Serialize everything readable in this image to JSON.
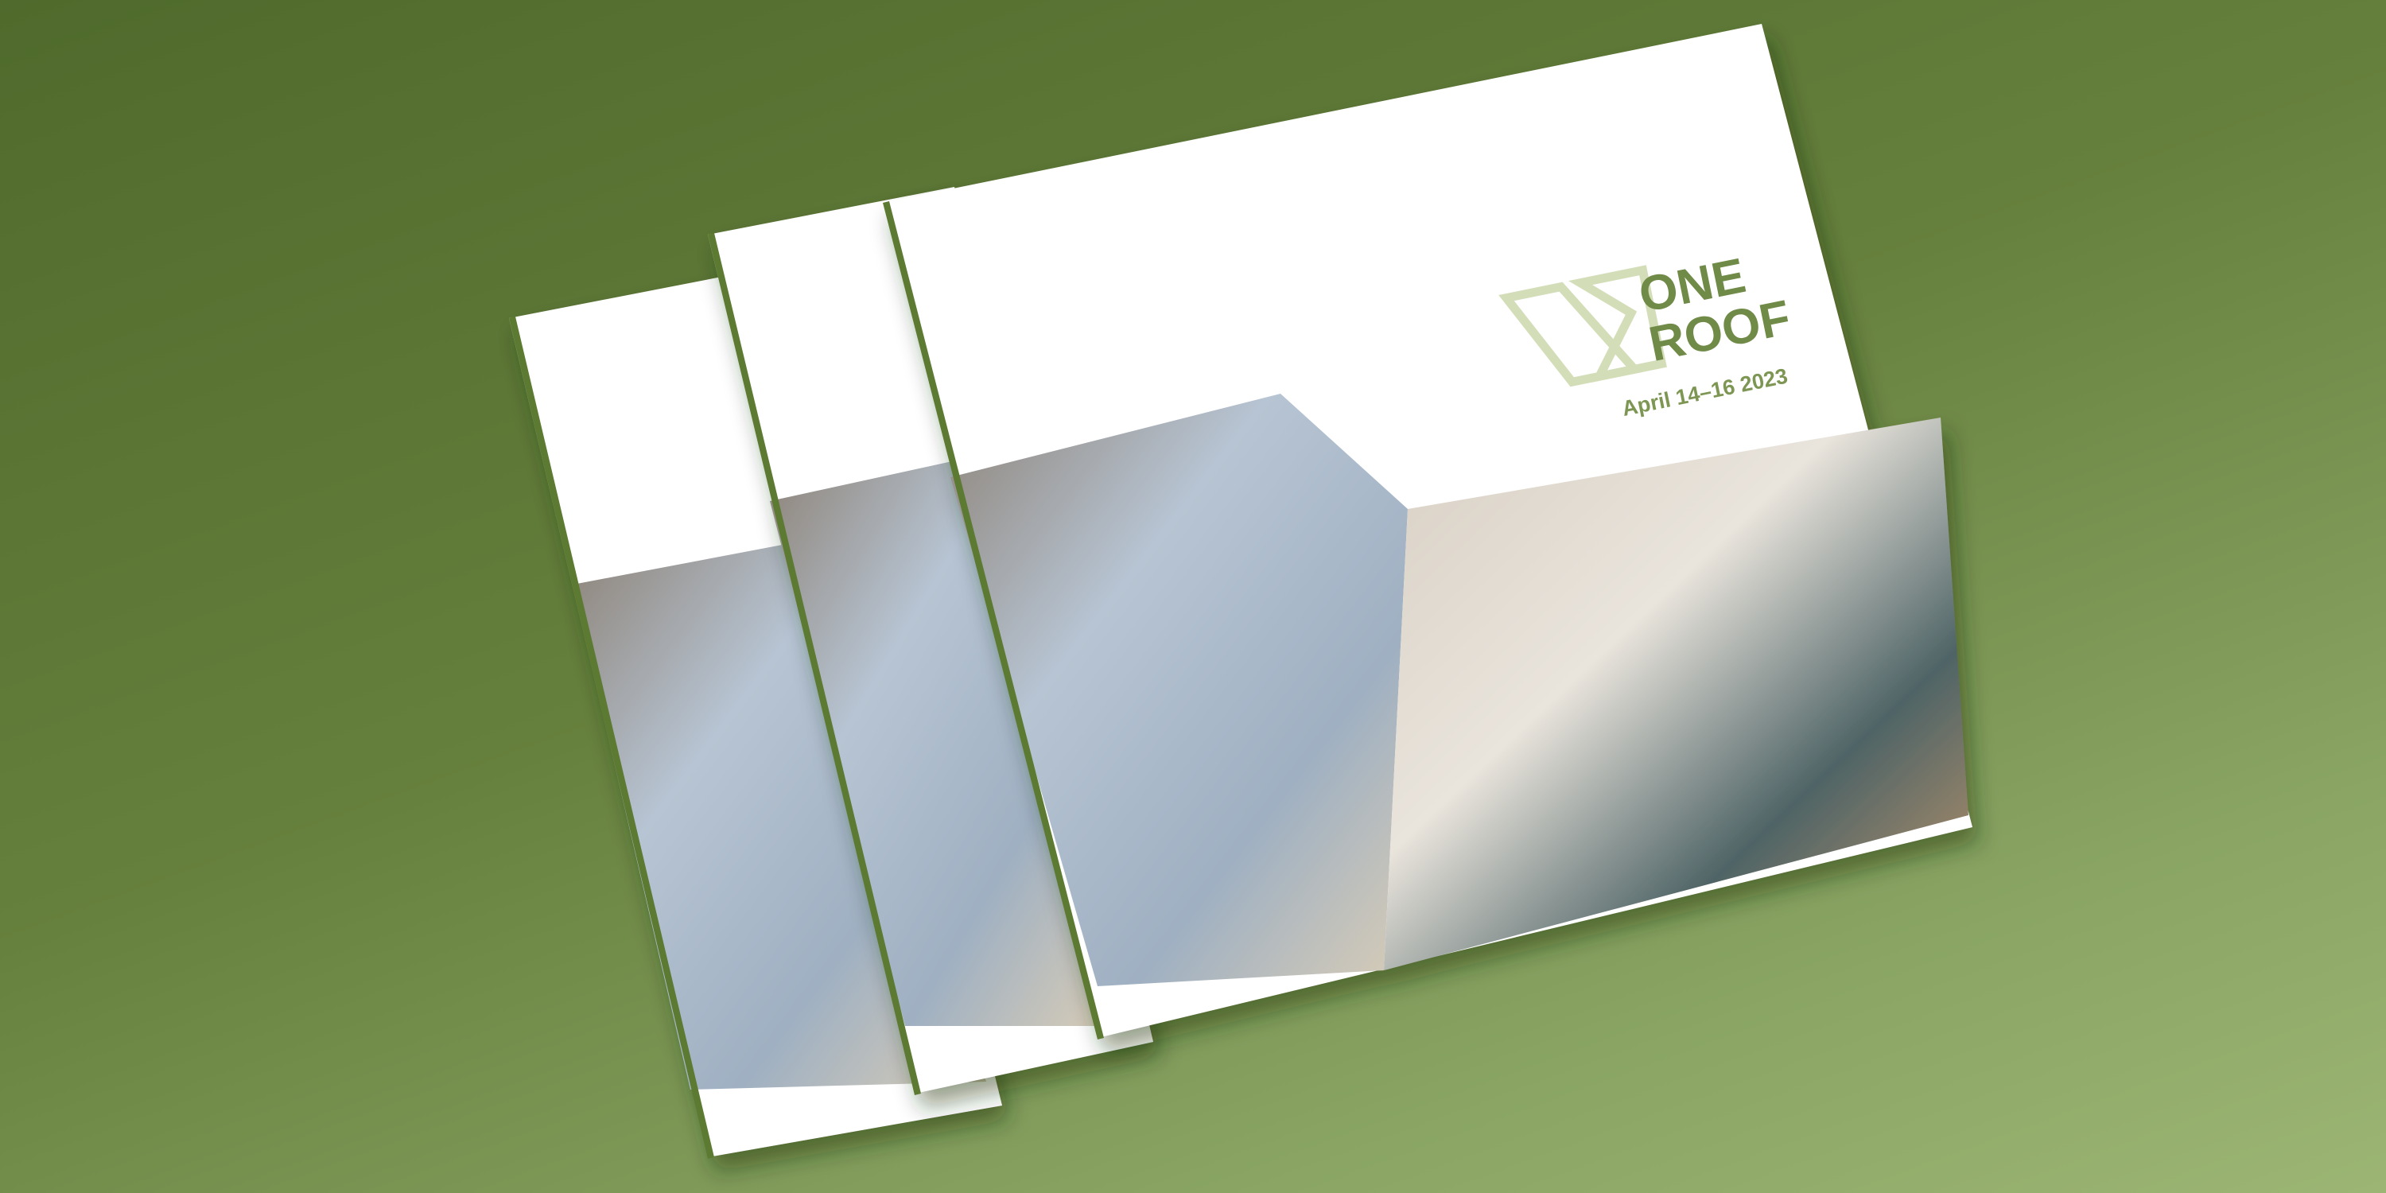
{
  "cover": {
    "logo_line1": "ONE",
    "logo_line2": "ROOF",
    "date": "April 14–16 2023"
  },
  "colors": {
    "background": "#657f3c",
    "logo_text": "#6f8a46",
    "logo_mark": "#d3deb9",
    "spine": "#5c7a30"
  }
}
